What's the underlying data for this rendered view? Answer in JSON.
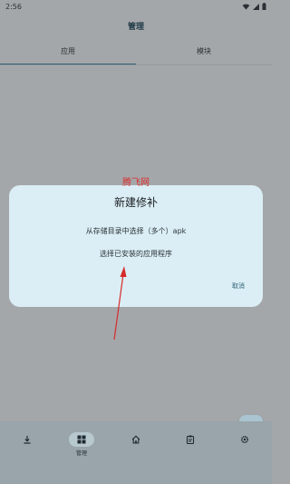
{
  "status_bar": {
    "time": "2:56"
  },
  "app": {
    "title": "管理"
  },
  "tabs": [
    {
      "label": "应用",
      "active": true
    },
    {
      "label": "模块",
      "active": false
    }
  ],
  "dialog": {
    "watermark": "腾飞网",
    "title": "新建修补",
    "options": [
      "从存储目录中选择（多个）apk",
      "选择已安装的应用程序"
    ],
    "cancel_label": "取消"
  },
  "fab": {
    "icon": "plus-icon"
  },
  "bottom_nav": {
    "items": [
      {
        "icon": "download-icon",
        "label": ""
      },
      {
        "icon": "grid-icon",
        "label": "管理",
        "active": true
      },
      {
        "icon": "home-icon",
        "label": ""
      },
      {
        "icon": "clipboard-icon",
        "label": ""
      },
      {
        "icon": "gear-icon",
        "label": ""
      }
    ]
  },
  "colors": {
    "scrim": "#a4a7aa",
    "dialog_bg": "#dbeef5",
    "accent": "#2f5f6f",
    "watermark": "#d83030",
    "annotation_arrow": "#d62a2a"
  }
}
